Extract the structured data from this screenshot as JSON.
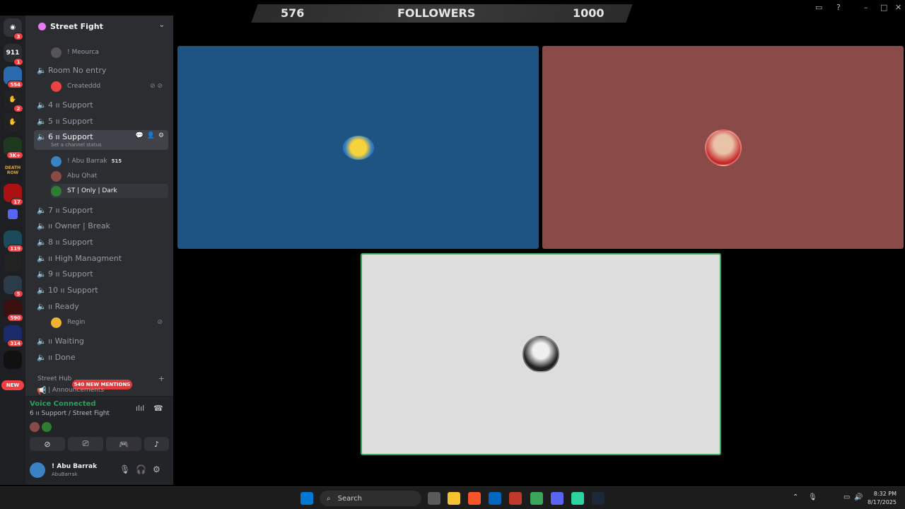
{
  "overlay": {
    "left_count": "576",
    "label": "FOLLOWERS",
    "right_count": "1000"
  },
  "server": {
    "name": "Street Fight"
  },
  "rail_badges": [
    "3",
    "1",
    "554",
    "2",
    "3K+",
    "17",
    "119",
    "5",
    "590",
    "314"
  ],
  "rail_labels": {
    "death_row": "DEATH ROW",
    "new": "NEW"
  },
  "channels": {
    "top_member": "! Meourca",
    "room_no_entry": "Room No entry",
    "room_member": "Createddd",
    "ch4": "4 ıı Support",
    "ch5": "5 ıı Support",
    "ch6": "6 ıı Support",
    "ch6_status": "Set a channel status",
    "ch6_members": [
      {
        "name": "! Abu Barrak",
        "tag": "515"
      },
      {
        "name": "Abu Qhat"
      },
      {
        "name": "ST | Only | Dark"
      }
    ],
    "ch7": "7 ıı Support",
    "owner_break": "ıı Owner | Break",
    "ch8": "8 ıı Support",
    "high_mgmt": "ıı High Managment",
    "ch9": "9 ıı Support",
    "ch10": "10 ıı Support",
    "ready": "ıı Ready",
    "ready_member": "Regin",
    "waiting": "ıı Waiting",
    "done": "ıı Done",
    "category": "Street Hub",
    "announcements": "| Announcements"
  },
  "mentions_pill": "540 NEW MENTIONS",
  "voice": {
    "status": "Voice Connected",
    "location": "6 ıı Support / Street Fight"
  },
  "user": {
    "name": "! Abu Barrak",
    "handle": "AbuBarrak"
  },
  "taskbar": {
    "search": "Search",
    "time": "8:32 PM",
    "date": "8/17/2025"
  },
  "colors": {
    "tile_blue": "#1d5483",
    "tile_red": "#8a4a48",
    "tile_gray": "#dddddd",
    "speaking_border": "#3ba55c"
  }
}
